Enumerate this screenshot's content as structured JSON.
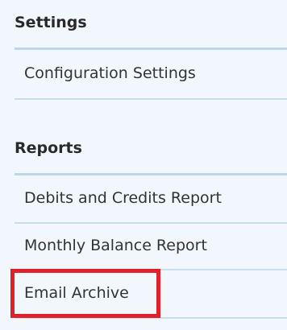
{
  "sections": [
    {
      "header": "Settings",
      "items": [
        {
          "label": "Configuration Settings"
        }
      ]
    },
    {
      "header": "Reports",
      "items": [
        {
          "label": "Debits and Credits Report"
        },
        {
          "label": "Monthly Balance Report"
        },
        {
          "label": "Email Archive"
        }
      ]
    }
  ],
  "highlight": {
    "target": "Email Archive",
    "color": "#e0202a"
  },
  "colors": {
    "panel_background": "#f1f7fc",
    "divider": "#c7deef",
    "text": "#333333"
  }
}
